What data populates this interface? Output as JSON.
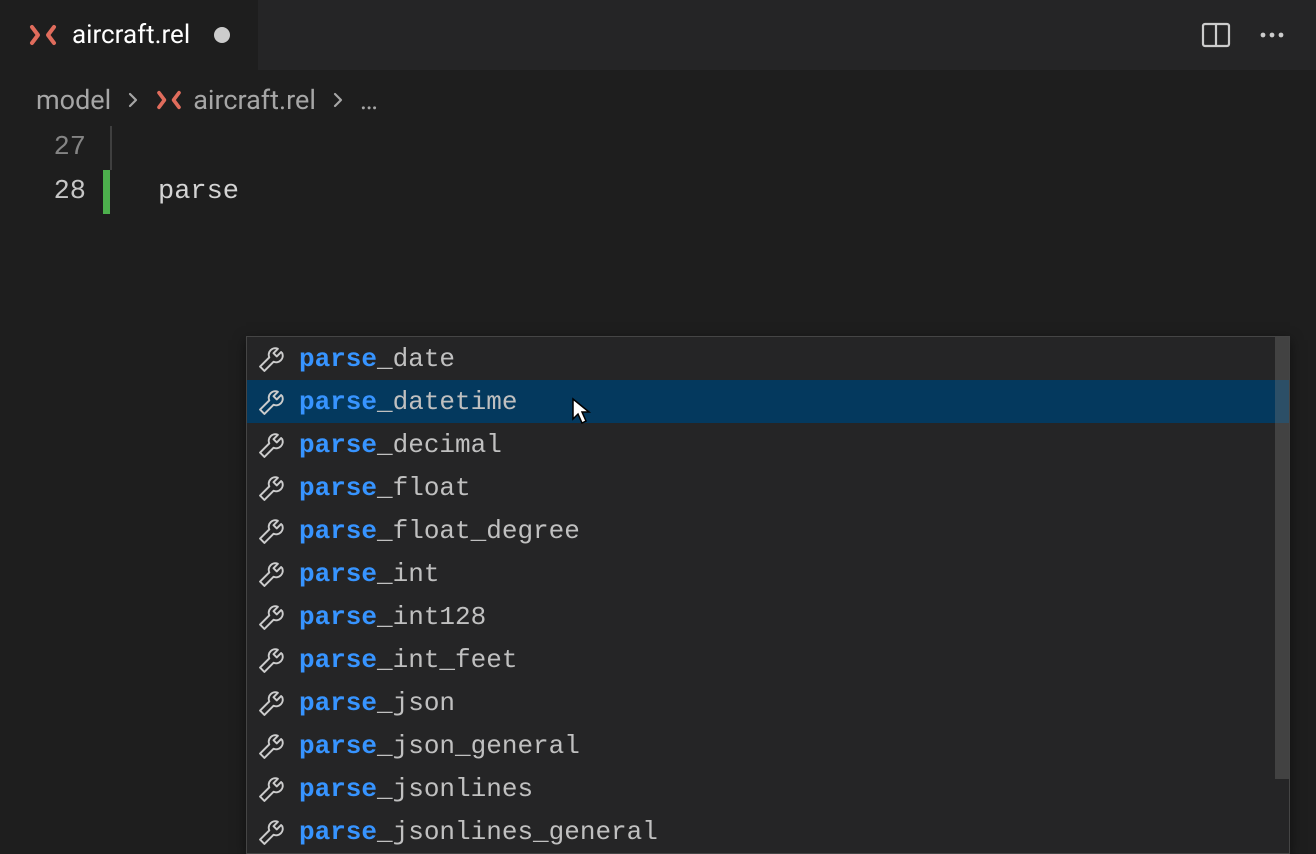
{
  "tab": {
    "title": "aircraft.rel",
    "dirty": true
  },
  "breadcrumbs": {
    "folder": "model",
    "file": "aircraft.rel",
    "symbol": "…"
  },
  "editor": {
    "lines": [
      {
        "num": "27",
        "text": ""
      },
      {
        "num": "28",
        "text": "parse"
      }
    ],
    "active_line_index": 1
  },
  "suggest": {
    "typed_prefix": "parse",
    "selected_index": 1,
    "items": [
      {
        "match": "parse",
        "rest": "_date"
      },
      {
        "match": "parse",
        "rest": "_datetime"
      },
      {
        "match": "parse",
        "rest": "_decimal"
      },
      {
        "match": "parse",
        "rest": "_float"
      },
      {
        "match": "parse",
        "rest": "_float_degree"
      },
      {
        "match": "parse",
        "rest": "_int"
      },
      {
        "match": "parse",
        "rest": "_int128"
      },
      {
        "match": "parse",
        "rest": "_int_feet"
      },
      {
        "match": "parse",
        "rest": "_json"
      },
      {
        "match": "parse",
        "rest": "_json_general"
      },
      {
        "match": "parse",
        "rest": "_jsonlines"
      },
      {
        "match": "parse",
        "rest": "_jsonlines_general"
      }
    ]
  }
}
